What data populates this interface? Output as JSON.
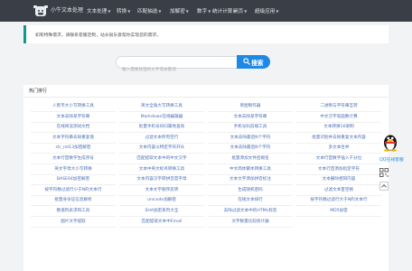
{
  "brand": "小牛文本处理",
  "nav": [
    {
      "label": "文本处理",
      "has_caret": true
    },
    {
      "label": "转换",
      "has_caret": true
    },
    {
      "label": "匹配抽选",
      "has_caret": true
    },
    {
      "label": "加解密",
      "has_caret": true
    },
    {
      "label": "数字",
      "has_caret": true
    },
    {
      "label": "统计计算",
      "has_caret": true
    },
    {
      "label": "网页",
      "has_caret": true
    },
    {
      "label": "超级应用",
      "has_caret": true
    }
  ],
  "notice": "如有特殊需求，请联系客服定制，站长很乐意帮你实现您的需求。",
  "search": {
    "placeholder": "输入需要处理的文字或关键词",
    "button_label": "搜索"
  },
  "hot": {
    "title": "热门排行",
    "items": [
      "人民币大小写转换工具",
      "英文全角大写转换工具",
      "草图制作器",
      "二进制与字符串互转",
      "文本去除某字符串",
      "Markdown在线编辑器",
      "文本去除某字符串",
      "中文汉字笔画数计算",
      "在线阅读测试文档",
      "批量手机号码归属地查询",
      "手机号码前缀工具",
      "文本转换16进制",
      "文本字符串去除重复值",
      "过滤文本所有空行",
      "文本去除最后N个字符",
      "批量识别并去除重复文本内容",
      "str_rot13加密解密",
      "文本内容以特定字符开头",
      "文本去除最后N个字符",
      "多文本合并",
      "文本行首数字生成序号",
      "匹配提取文本中的中文汉字",
      "批量添加文件后缀名",
      "文本行首数字插入千分位",
      "英文字母大小写转换",
      "文本中英文标点转换工具",
      "中文简体繁体转换工具",
      "文本行首添加指定字符",
      "BASE64加密解密",
      "文本内容汉字转拼音首字母",
      "文本文字添加拼音标注",
      "文本删除相同内容",
      "按字符数过滤行小于N的文本行",
      "文本文字顺序反转",
      "生成随机密码",
      "过滤文本首空格",
      "批量身份证信息解析",
      "unicode加解密",
      "在线文本排行",
      "按字符数过滤行大于N的文本行",
      "数值列表求和工具",
      "SHA加密系列大全",
      "去除过滤文本中的HTML标签",
      "MD5加密",
      "图片文字提取",
      "匹配提取文本中Email",
      "文字数量比较统计器"
    ]
  },
  "side": {
    "qq_label": "QQ在线客服"
  }
}
